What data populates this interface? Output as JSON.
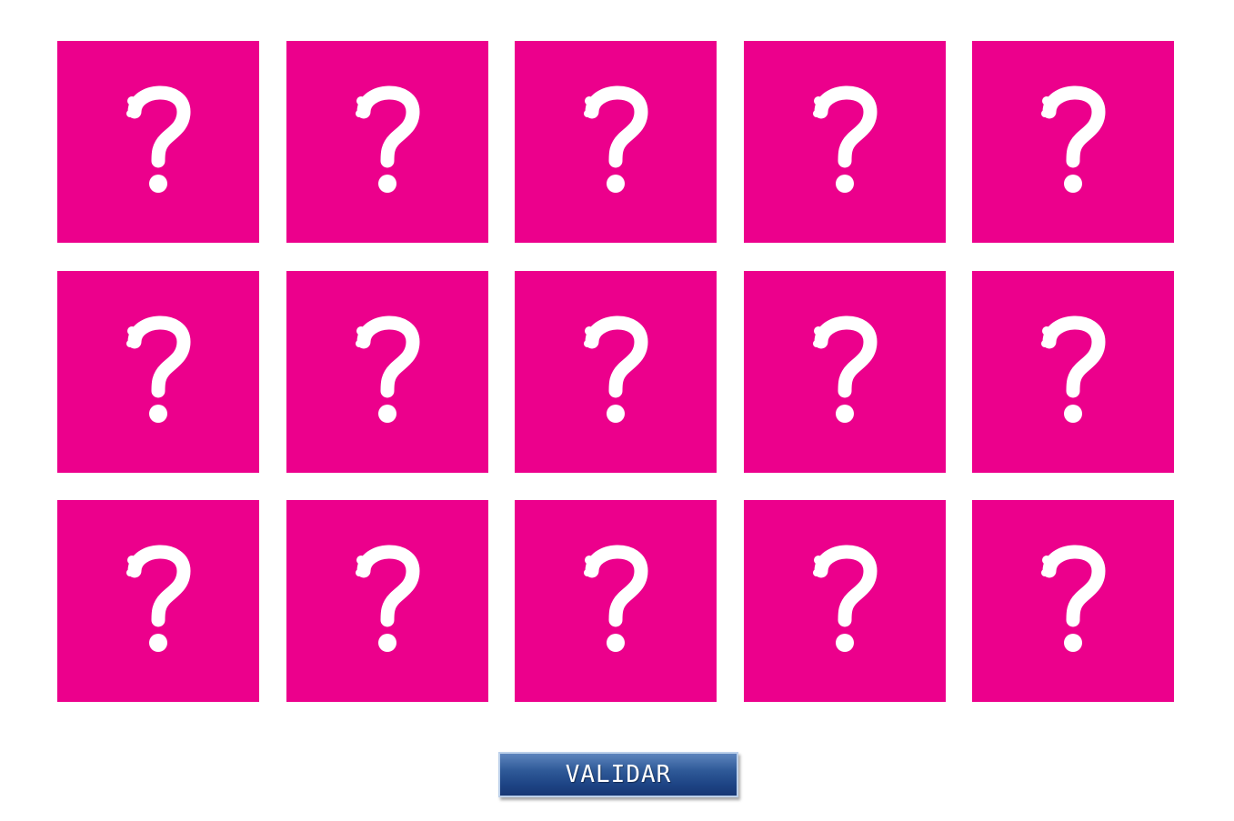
{
  "card_color": "#ec008c",
  "icon_color": "#ffffff",
  "card_icon": "question-mark-icon",
  "cards": [
    {
      "id": 1
    },
    {
      "id": 2
    },
    {
      "id": 3
    },
    {
      "id": 4
    },
    {
      "id": 5
    },
    {
      "id": 6
    },
    {
      "id": 7
    },
    {
      "id": 8
    },
    {
      "id": 9
    },
    {
      "id": 10
    },
    {
      "id": 11
    },
    {
      "id": 12
    },
    {
      "id": 13
    },
    {
      "id": 14
    },
    {
      "id": 15
    }
  ],
  "validate_button": {
    "label": "VALIDAR",
    "color": "#2f5a98"
  }
}
